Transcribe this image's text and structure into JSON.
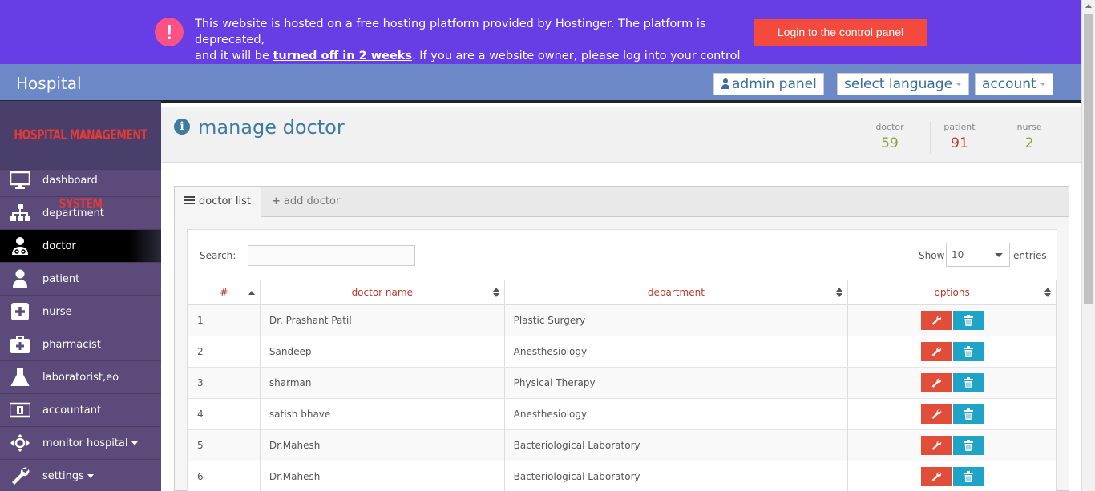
{
  "banner": {
    "line1": "This website is hosted on a free hosting platform provided by Hostinger. The platform is deprecated,",
    "line2_pre": "and it will be ",
    "line2_bold": "turned off in 2 weeks",
    "line2_post": ". If you are a website owner, please log into your control panel here.",
    "login_label": "Login to the control panel",
    "alert_glyph": "!"
  },
  "header": {
    "brand": "Hospital",
    "admin_panel": "admin panel",
    "select_language": "select language",
    "account": "account"
  },
  "sidebar": {
    "logo_text": "HOSPITAL MANAGEMENT SYSTEM",
    "items": [
      {
        "label": "dashboard",
        "icon": "monitor-icon"
      },
      {
        "label": "department",
        "icon": "sitemap-icon"
      },
      {
        "label": "doctor",
        "icon": "user-md-icon"
      },
      {
        "label": "patient",
        "icon": "user-icon"
      },
      {
        "label": "nurse",
        "icon": "plus-square-icon"
      },
      {
        "label": "pharmacist",
        "icon": "medkit-icon"
      },
      {
        "label": "laboratorist,eo",
        "icon": "flask-icon"
      },
      {
        "label": "accountant",
        "icon": "money-icon"
      },
      {
        "label": "monitor hospital",
        "icon": "crosshairs-icon"
      },
      {
        "label": "settings",
        "icon": "wrench-icon"
      }
    ]
  },
  "page": {
    "title": "manage doctor",
    "stats": [
      {
        "label": "doctor",
        "value": "59",
        "color": "#8aa33a"
      },
      {
        "label": "patient",
        "value": "91",
        "color": "#c0392b"
      },
      {
        "label": "nurse",
        "value": "2",
        "color": "#8aa33a"
      }
    ]
  },
  "tabs": {
    "list": "doctor list",
    "add": "add doctor"
  },
  "table_controls": {
    "search_label": "Search:",
    "show_label": "Show",
    "show_value": "10",
    "entries_label": "entries"
  },
  "table": {
    "headers": [
      "#",
      "doctor name",
      "department",
      "options"
    ],
    "rows": [
      [
        "1",
        "Dr. Prashant Patil",
        "Plastic Surgery"
      ],
      [
        "2",
        "Sandeep",
        "Anesthesiology"
      ],
      [
        "3",
        "sharman",
        "Physical Therapy"
      ],
      [
        "4",
        "satish bhave",
        "Anesthesiology"
      ],
      [
        "5",
        "Dr.Mahesh",
        "Bacteriological Laboratory"
      ],
      [
        "6",
        "Dr.Mahesh",
        "Bacteriological Laboratory"
      ]
    ]
  },
  "colors": {
    "banner": "#673de6",
    "topbar": "#6c88c7",
    "sidebar": "#5c4a7a",
    "edit": "#e04e39",
    "delete": "#1fa3c6"
  }
}
